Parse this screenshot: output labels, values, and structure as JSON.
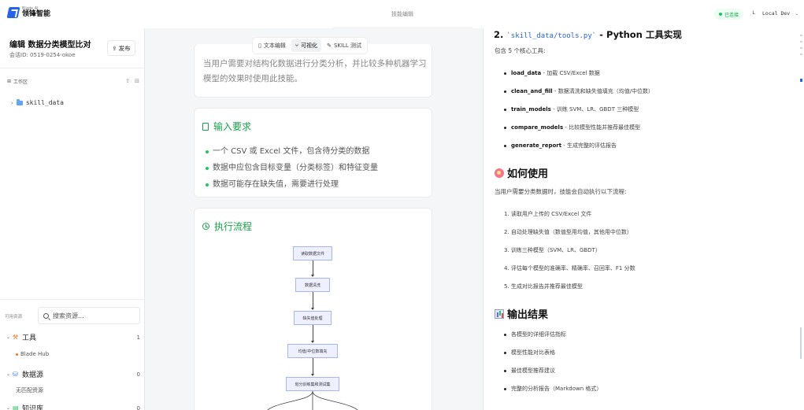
{
  "topbar": {
    "logo_small": "Blade AI",
    "logo_name": "领锋智能",
    "center_title": "技能编辑",
    "status": "已连接",
    "env_avatar": "L",
    "env_name": "Local Dev"
  },
  "sidebar": {
    "title": "编辑 数据分类模型比对",
    "session": "会话ID: 0519-0254-okoe",
    "publish_label": "发布",
    "workspace_label": "工作区",
    "tree_root": "skill_data",
    "resources_label": "可用资源",
    "search_placeholder": "搜索资源...",
    "groups": [
      {
        "label": "工具",
        "count": "1",
        "child": "Blade Hub"
      },
      {
        "label": "数据源",
        "count": "0",
        "child": "无匹配资源"
      },
      {
        "label": "知识库",
        "count": "0"
      }
    ]
  },
  "editor": {
    "tabs": [
      {
        "label": "文本编辑",
        "icon": "doc-icon"
      },
      {
        "label": "可视化",
        "icon": "branch-icon"
      },
      {
        "label": "SKILL 测试",
        "icon": "pen-icon"
      }
    ],
    "intro": "当用户需要对结构化数据进行分类分析，并比较多种机器学习模型的效果时使用此技能。",
    "input_section": {
      "title": "输入要求",
      "items": [
        "一个 CSV 或 Excel 文件，包含待分类的数据",
        "数据中应包含目标变量（分类标签）和特征变量",
        "数据可能存在缺失值，需要进行处理"
      ]
    },
    "flow_section": {
      "title": "执行流程",
      "nodes": [
        "读取数据文件",
        "数据清洗",
        "缺失值处理",
        "均值/中位数填充",
        "划分训练集和测试集"
      ]
    }
  },
  "preview": {
    "tools_heading_prefix": "2. ",
    "tools_heading_code": "`skill_data/tools.py`",
    "tools_heading_suffix": " - Python 工具实现",
    "tools_intro": "包含 5 个核心工具:",
    "tools": [
      {
        "name": "load_data",
        "desc": " - 加载 CSV/Excel 数据"
      },
      {
        "name": "clean_and_fill",
        "desc": " - 数据清洗和缺失值填充（均值/中位数）"
      },
      {
        "name": "train_models",
        "desc": " - 训练 SVM、LR、GBDT 三种模型"
      },
      {
        "name": "compare_models",
        "desc": " - 比较模型性能并推荐最佳模型"
      },
      {
        "name": "generate_report",
        "desc": " - 生成完整的评估报告"
      }
    ],
    "usage_heading": "如何使用",
    "usage_intro": "当用户需要分类数据时，技能会自动执行以下流程:",
    "steps": [
      "1. 读取用户上传的 CSV/Excel 文件",
      "2. 自动处理缺失值（数值型用均值，其他用中位数）",
      "3. 训练三种模型（SVM、LR、GBDT）",
      "4. 评估每个模型的准确率、精确率、召回率、F1 分数",
      "5. 生成对比报告并推荐最佳模型"
    ],
    "output_heading": "输出结果",
    "outputs": [
      "各模型的详细评估指标",
      "模型性能对比表格",
      "最佳模型推荐建议",
      "完整的分析报告（Markdown 格式）"
    ]
  }
}
